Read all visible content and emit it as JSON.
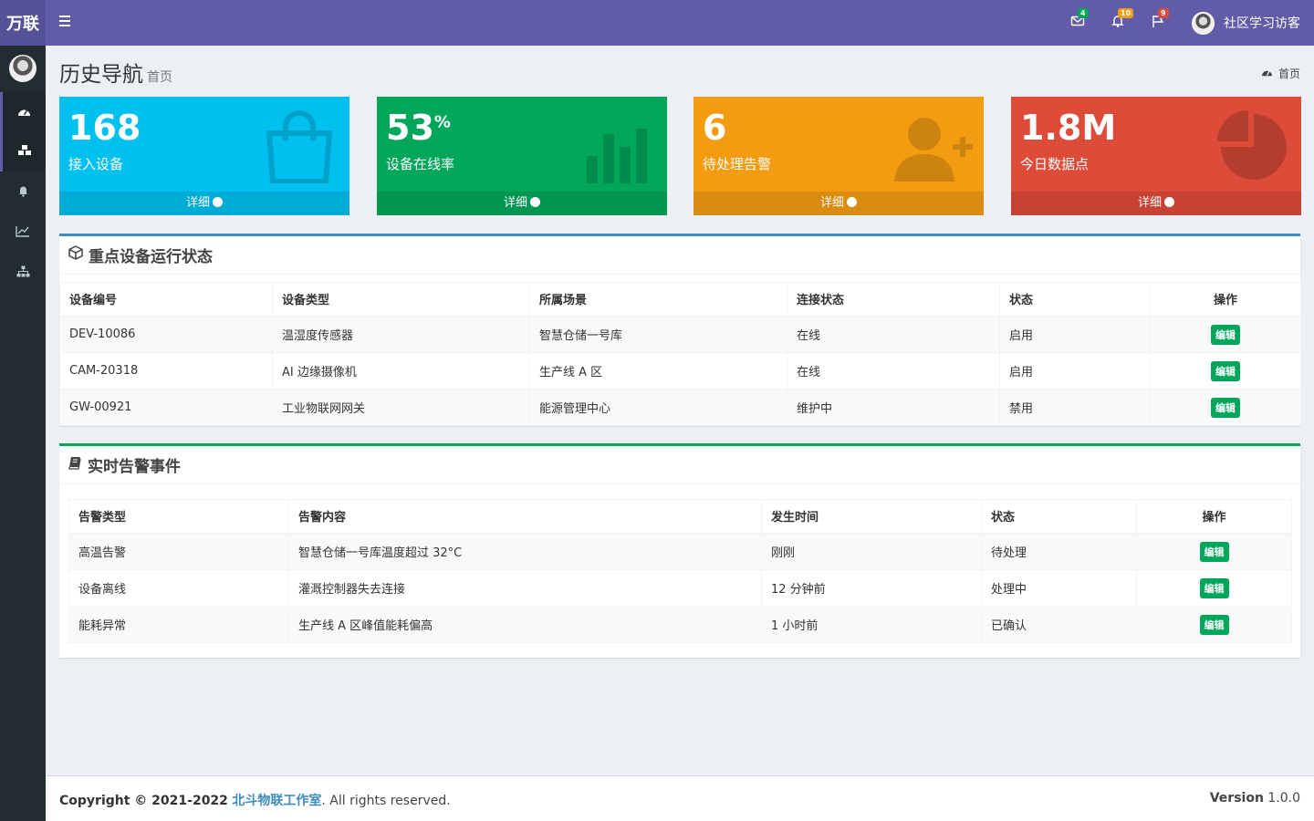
{
  "brand": "万联",
  "header": {
    "badges": {
      "mail": "4",
      "bell": "10",
      "flag": "9"
    },
    "user_name": "社区学习访客"
  },
  "page": {
    "title": "历史导航",
    "subtitle": "首页",
    "breadcrumb": "首页"
  },
  "stats": [
    {
      "value": "168",
      "suffix": "",
      "label": "接入设备",
      "more": "详细",
      "color": "#00c0ef",
      "icon": "shopping-bag-icon"
    },
    {
      "value": "53",
      "suffix": "%",
      "label": "设备在线率",
      "more": "详细",
      "color": "#00a65a",
      "icon": "bar-chart-icon"
    },
    {
      "value": "6",
      "suffix": "",
      "label": "待处理告警",
      "more": "详细",
      "color": "#f39c12",
      "icon": "user-plus-icon"
    },
    {
      "value": "1.8M",
      "suffix": "",
      "label": "今日数据点",
      "more": "详细",
      "color": "#dd4b39",
      "icon": "pie-chart-icon"
    }
  ],
  "devices": {
    "title": "重点设备运行状态",
    "columns": [
      "设备编号",
      "设备类型",
      "所属场景",
      "连接状态",
      "状态",
      "操作"
    ],
    "rows": [
      [
        "DEV-10086",
        "温湿度传感器",
        "智慧仓储一号库",
        "在线",
        "启用",
        "编辑"
      ],
      [
        "CAM-20318",
        "AI 边缘摄像机",
        "生产线 A 区",
        "在线",
        "启用",
        "编辑"
      ],
      [
        "GW-00921",
        "工业物联网网关",
        "能源管理中心",
        "维护中",
        "禁用",
        "编辑"
      ]
    ]
  },
  "alerts": {
    "title": "实时告警事件",
    "columns": [
      "告警类型",
      "告警内容",
      "发生时间",
      "状态",
      "操作"
    ],
    "rows": [
      [
        "高温告警",
        "智慧仓储一号库温度超过 32°C",
        "刚刚",
        "待处理",
        "编辑"
      ],
      [
        "设备离线",
        "灌溉控制器失去连接",
        "12 分钟前",
        "处理中",
        "编辑"
      ],
      [
        "能耗异常",
        "生产线 A 区峰值能耗偏高",
        "1 小时前",
        "已确认",
        "编辑"
      ]
    ]
  },
  "footer": {
    "copyright": "Copyright © 2021-2022",
    "company": "北斗物联工作室",
    "rights": ". All rights reserved.",
    "version_label": "Version",
    "version": "1.0.0"
  }
}
